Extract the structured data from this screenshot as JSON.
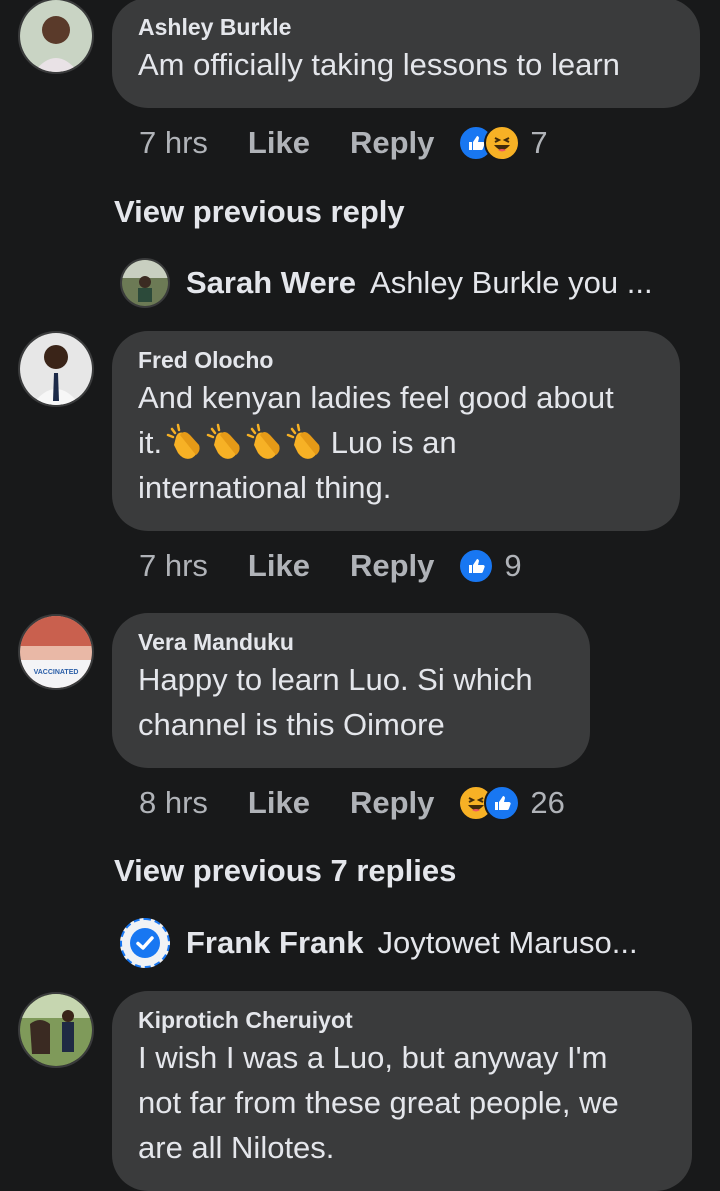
{
  "comments": [
    {
      "author": "Ashley Burkle",
      "text_lines": [
        "Am officially taking lessons to learn"
      ],
      "time": "7 hrs",
      "like": "Like",
      "reply": "Reply",
      "reactions": [
        "like-icon",
        "laugh-icon"
      ],
      "reaction_count": "7"
    },
    {
      "author": "Fred Olocho",
      "text_line1": "And kenyan ladies feel good about",
      "text_line2_start": "it.",
      "text_line2_end": " Luo is  an",
      "text_line3": "international thing.",
      "clap_emoji_count": 4,
      "time": "7 hrs",
      "like": "Like",
      "reply": "Reply",
      "reactions": [
        "like-icon"
      ],
      "reaction_count": "9"
    },
    {
      "author": "Vera Manduku",
      "text_lines": [
        "Happy to learn Luo. Si which",
        "channel is this Oimore"
      ],
      "avatar_badge": "VACCINATED",
      "time": "8 hrs",
      "like": "Like",
      "reply": "Reply",
      "reactions": [
        "laugh-icon",
        "like-icon"
      ],
      "reaction_count": "26"
    },
    {
      "author": "Kiprotich Cheruiyot",
      "text_lines": [
        "I wish I was a Luo, but anyway I'm",
        "not far from these great people, we",
        "are all Nilotes."
      ]
    }
  ],
  "view_previous_1": "View previous reply",
  "view_previous_2": "View previous 7 replies",
  "reply_preview_1": {
    "name": "Sarah Were",
    "snippet": "Ashley Burkle you ..."
  },
  "reply_preview_2": {
    "name": "Frank Frank",
    "snippet": "Joytowet Maruso..."
  },
  "colors": {
    "background": "#18191a",
    "bubble": "#3a3b3c",
    "primary_text": "#e4e6eb",
    "secondary_text": "#b0b3b8",
    "like_blue": "#1877f2",
    "haha_yellow": "#f7b125"
  }
}
